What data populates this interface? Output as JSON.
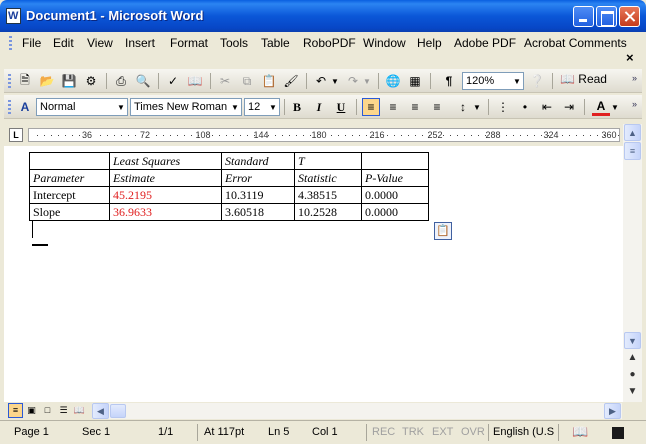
{
  "window": {
    "title": "Document1 - Microsoft Word"
  },
  "menu": {
    "items": [
      "File",
      "Edit",
      "View",
      "Insert",
      "Format",
      "Tools",
      "Table",
      "RoboPDF",
      "Window",
      "Help",
      "Adobe PDF",
      "Acrobat Comments"
    ],
    "close_glyph": "×"
  },
  "standard_toolbar": {
    "zoom": "120%",
    "read_label": "Read"
  },
  "formatting_toolbar": {
    "style": "Normal",
    "font": "Times New Roman",
    "size": "12"
  },
  "ruler": {
    "labels": [
      "36",
      "72",
      "108",
      "144",
      "180",
      "216",
      "252",
      "288",
      "324",
      "360"
    ]
  },
  "document": {
    "table": {
      "rows": [
        [
          "",
          "Least Squares",
          "Standard",
          "T",
          ""
        ],
        [
          "Parameter",
          "Estimate",
          "Error",
          "Statistic",
          "P-Value"
        ],
        [
          "Intercept",
          "45.2195",
          "10.3119",
          "4.38515",
          "0.0000"
        ],
        [
          "Slope",
          "36.9633",
          "3.60518",
          "10.2528",
          "0.0000"
        ]
      ]
    },
    "highlight_color": "#e02020"
  },
  "status": {
    "page": "Page 1",
    "sec": "Sec 1",
    "pages": "1/1",
    "at": "At  117pt",
    "ln": "Ln  5",
    "col": "Col  1",
    "rec": "REC",
    "trk": "TRK",
    "ext": "EXT",
    "ovr": "OVR",
    "language": "English (U.S"
  }
}
